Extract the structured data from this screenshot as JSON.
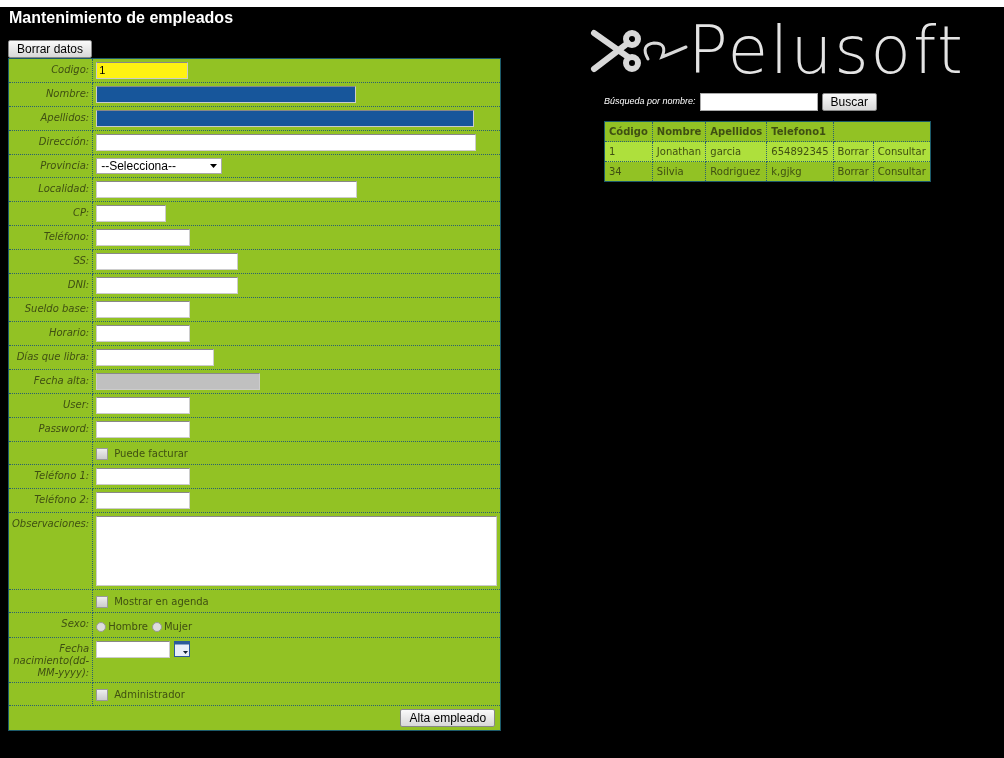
{
  "page_title": "Mantenimiento de empleados",
  "clear_button": "Borrar datos",
  "form_rows": [
    {
      "kind": "text",
      "label": "Codigo:",
      "value": "1",
      "color": "#fff212"
    },
    {
      "kind": "text",
      "label": "Nombre:",
      "color": "#17569b"
    },
    {
      "kind": "text",
      "label": "Apellidos:",
      "color": "#17569b"
    },
    {
      "kind": "text",
      "label": "Dirección:"
    },
    {
      "kind": "select",
      "label": "Provincia:",
      "value": "--Selecciona--"
    },
    {
      "kind": "text",
      "label": "Localidad:"
    },
    {
      "kind": "text",
      "label": "CP:"
    },
    {
      "kind": "text",
      "label": "Teléfono:"
    },
    {
      "kind": "text",
      "label": "SS:"
    },
    {
      "kind": "text",
      "label": "DNI:"
    },
    {
      "kind": "text",
      "label": "Sueldo base:"
    },
    {
      "kind": "text",
      "label": "Horario:"
    },
    {
      "kind": "text",
      "label": "Días que libra:"
    },
    {
      "kind": "text",
      "label": "Fecha alta:",
      "disabled": true
    },
    {
      "kind": "text",
      "label": "User:"
    },
    {
      "kind": "text",
      "label": "Password:"
    },
    {
      "kind": "checkbox",
      "text": "Puede facturar",
      "checked": false
    },
    {
      "kind": "text",
      "label": "Teléfono 1:"
    },
    {
      "kind": "text",
      "label": "Teléfono 2:"
    },
    {
      "kind": "textarea",
      "label": "Observaciones:"
    },
    {
      "kind": "checkbox",
      "text": "Mostrar en agenda",
      "checked": false
    },
    {
      "kind": "radio",
      "label": "Sexo:",
      "options": [
        {
          "label": "Hombre",
          "selected": false
        },
        {
          "label": "Mujer",
          "selected": false
        }
      ]
    },
    {
      "kind": "date",
      "label": "Fecha nacimiento(dd-MM-yyyy):"
    },
    {
      "kind": "checkbox",
      "text": "Administrador",
      "checked": false
    }
  ],
  "submit_button": "Alta empleado",
  "logo": {
    "text": "Pelusoft"
  },
  "search": {
    "label": "Búsqueda por nombre:",
    "button": "Buscar"
  },
  "results": {
    "columns": [
      "Código",
      "Nombre",
      "Apellidos",
      "Telefono1"
    ],
    "rows": [
      {
        "cells": [
          "1",
          "Jonathan",
          "garcia",
          "654892345"
        ],
        "actions": [
          "Borrar",
          "Consultar"
        ],
        "selected": true
      },
      {
        "cells": [
          "34",
          "Silvia",
          "Rodriguez",
          "k,gjkg"
        ],
        "actions": [
          "Borrar",
          "Consultar"
        ],
        "selected": false
      }
    ]
  }
}
